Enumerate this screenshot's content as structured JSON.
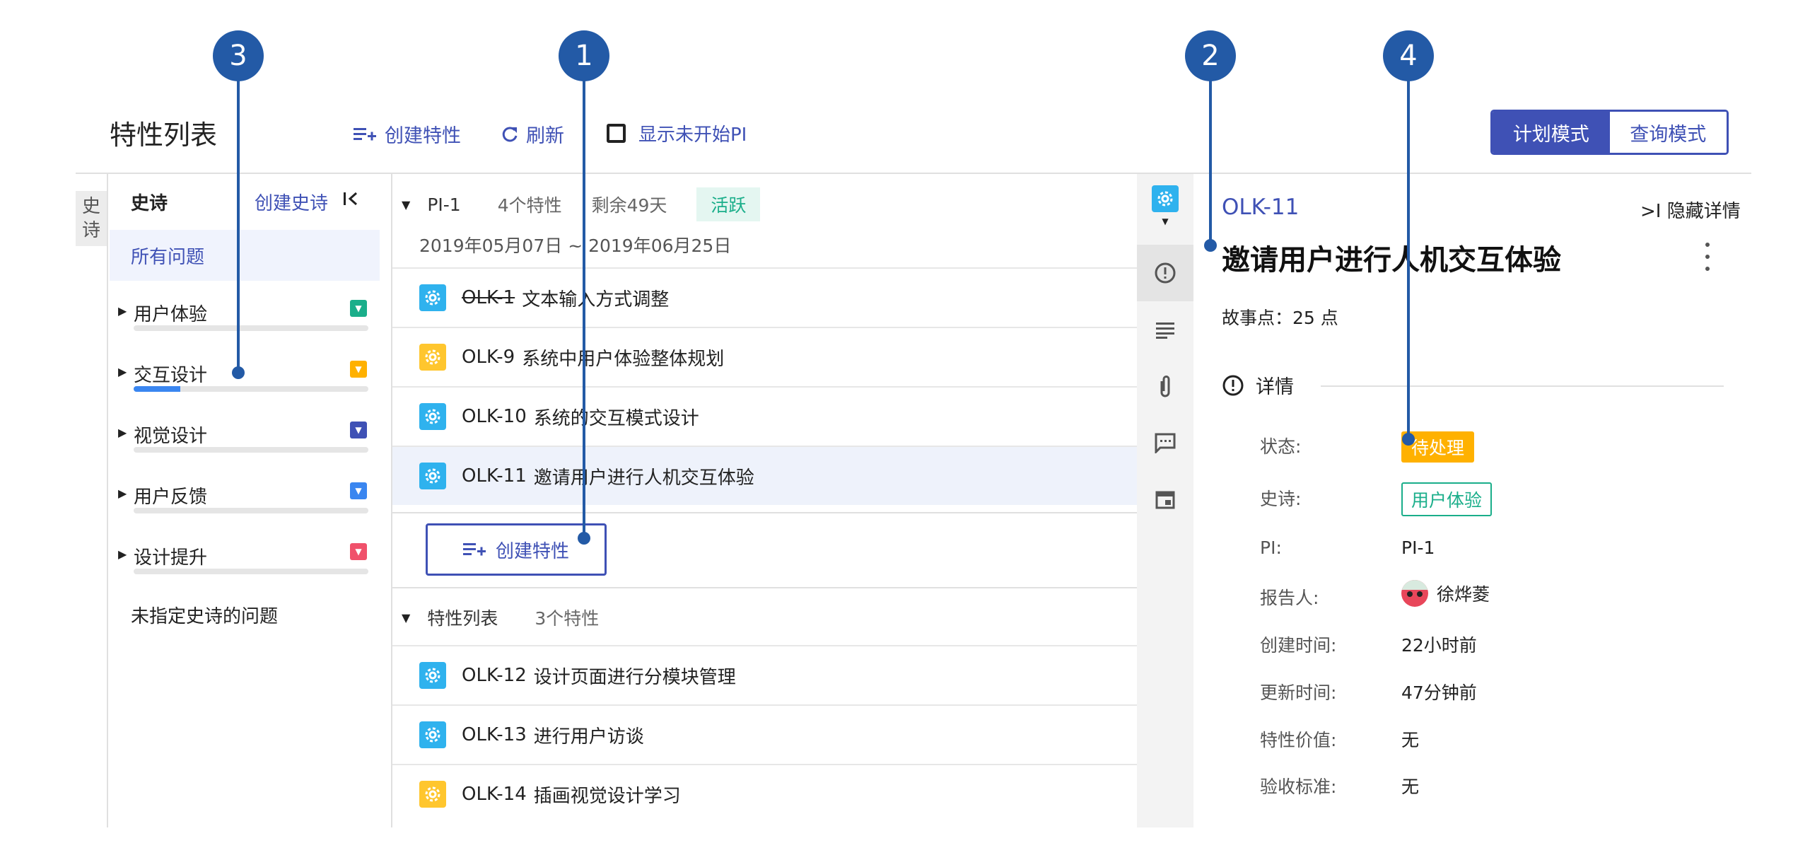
{
  "header": {
    "title": "特性列表",
    "create_feature": "创建特性",
    "refresh": "刷新",
    "show_unstarted_pi": "显示未开始PI",
    "mode_plan": "计划模式",
    "mode_query": "查询模式"
  },
  "left": {
    "vertical_tab": [
      "史",
      "诗"
    ],
    "heading": "史诗",
    "create_epic": "创建史诗",
    "collapse_icon": "collapse-left-icon",
    "all_issues": "所有问题",
    "epics": [
      {
        "name": "用户体验",
        "color": "#1aae8a",
        "progress": 0
      },
      {
        "name": "交互设计",
        "color": "#ffb100",
        "progress": 0.2
      },
      {
        "name": "视觉设计",
        "color": "#3f51b5",
        "progress": 0
      },
      {
        "name": "用户反馈",
        "color": "#3a86f0",
        "progress": 0
      },
      {
        "name": "设计提升",
        "color": "#f0516b",
        "progress": 0
      }
    ],
    "no_epic": "未指定史诗的问题"
  },
  "middle": {
    "pi": {
      "name": "PI-1",
      "count": "4个特性",
      "remaining": "剩余49天",
      "status": "活跃",
      "date_range": "2019年05月07日 ~ 2019年06月25日"
    },
    "pi_rows": [
      {
        "key": "OLK-1",
        "title": "文本输入方式调整",
        "icon_color": "#2fb2ee",
        "done": true
      },
      {
        "key": "OLK-9",
        "title": "系统中用户体验整体规划",
        "icon_color": "#ffc62e",
        "done": false
      },
      {
        "key": "OLK-10",
        "title": "系统的交互模式设计",
        "icon_color": "#2fb2ee",
        "done": false
      },
      {
        "key": "OLK-11",
        "title": "邀请用户进行人机交互体验",
        "icon_color": "#2fb2ee",
        "done": false
      }
    ],
    "create_feature_btn": "创建特性",
    "backlog": {
      "name": "特性列表",
      "count": "3个特性"
    },
    "backlog_rows": [
      {
        "key": "OLK-12",
        "title": "设计页面进行分模块管理",
        "icon_color": "#2fb2ee"
      },
      {
        "key": "OLK-13",
        "title": "进行用户访谈",
        "icon_color": "#2fb2ee"
      },
      {
        "key": "OLK-14",
        "title": "插画视觉设计学习",
        "icon_color": "#ffc62e"
      }
    ]
  },
  "detail": {
    "key": "OLK-11",
    "hide_details": ">I 隐藏详情",
    "title": "邀请用户进行人机交互体验",
    "story_points": "故事点：25 点",
    "section": "详情",
    "fields": {
      "status_label": "状态:",
      "status_value": "待处理",
      "epic_label": "史诗:",
      "epic_value": "用户体验",
      "pi_label": "PI:",
      "pi_value": "PI-1",
      "reporter_label": "报告人:",
      "reporter_value": "徐烨菱",
      "created_label": "创建时间:",
      "created_value": "22小时前",
      "updated_label": "更新时间:",
      "updated_value": "47分钟前",
      "value_label": "特性价值:",
      "value_value": "无",
      "acceptance_label": "验收标准:",
      "acceptance_value": "无"
    }
  },
  "callouts": [
    "1",
    "2",
    "3",
    "4"
  ],
  "colors": {
    "primary": "#3f51b5",
    "callout": "#235aa6",
    "active_green": "#1aae8a",
    "pending_yellow": "#ffb100"
  }
}
